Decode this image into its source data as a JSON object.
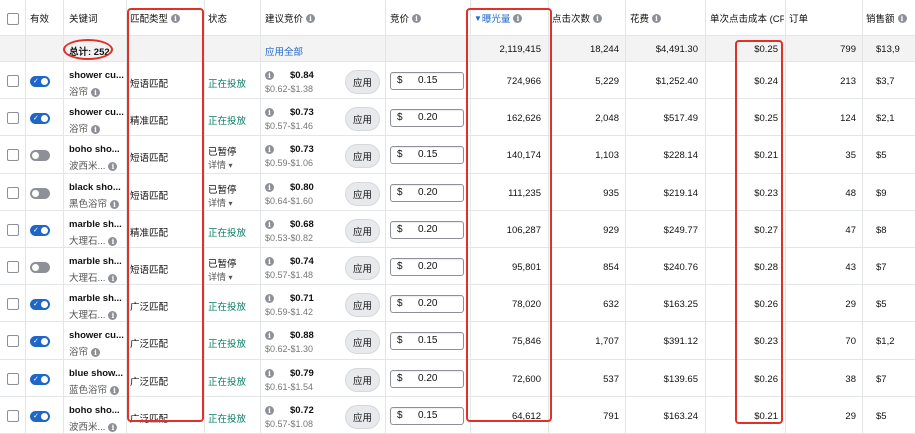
{
  "columns": {
    "enabled": "有效",
    "keyword": "关键词",
    "match_type": "匹配类型",
    "status": "状态",
    "suggested_bid": "建议竞价",
    "bid": "竞价",
    "impressions": "曝光量",
    "clicks": "点击次数",
    "spend": "花费",
    "cpc": "单次点击成本 (CPC",
    "orders": "订单",
    "sales": "销售额"
  },
  "sort_icon": "sort-desc-icon",
  "summary": {
    "total_label": "总计: 252",
    "apply_all": "应用全部",
    "impressions": "2,119,415",
    "clicks": "18,244",
    "spend": "$4,491.30",
    "cpc": "$0.25",
    "orders": "799",
    "sales": "$13,9"
  },
  "apply_label": "应用",
  "detail_label": "详情",
  "currency_symbol": "$",
  "colors": {
    "accent": "#1f66c9",
    "active_status": "#067d62",
    "highlight_red": "#e0302a"
  },
  "rows": [
    {
      "enabled": true,
      "kw": "shower cu...",
      "kw_sub": "浴帘",
      "match": "短语匹配",
      "status": "正在投放",
      "paused": false,
      "bid_sug": "$0.84",
      "bid_range": "$0.62-$1.38",
      "bid": "0.15",
      "impressions": "724,966",
      "clicks": "5,229",
      "spend": "$1,252.40",
      "cpc": "$0.24",
      "orders": "213",
      "sales": "$3,7"
    },
    {
      "enabled": true,
      "kw": "shower cu...",
      "kw_sub": "浴帘",
      "match": "精准匹配",
      "status": "正在投放",
      "paused": false,
      "bid_sug": "$0.73",
      "bid_range": "$0.57-$1.46",
      "bid": "0.20",
      "impressions": "162,626",
      "clicks": "2,048",
      "spend": "$517.49",
      "cpc": "$0.25",
      "orders": "124",
      "sales": "$2,1"
    },
    {
      "enabled": false,
      "kw": "boho sho...",
      "kw_sub": "波西米...",
      "match": "短语匹配",
      "status": "已暂停",
      "paused": true,
      "bid_sug": "$0.73",
      "bid_range": "$0.59-$1.06",
      "bid": "0.15",
      "impressions": "140,174",
      "clicks": "1,103",
      "spend": "$228.14",
      "cpc": "$0.21",
      "orders": "35",
      "sales": "$5"
    },
    {
      "enabled": false,
      "kw": "black sho...",
      "kw_sub": "黑色浴帘",
      "match": "短语匹配",
      "status": "已暂停",
      "paused": true,
      "bid_sug": "$0.80",
      "bid_range": "$0.64-$1.60",
      "bid": "0.20",
      "impressions": "111,235",
      "clicks": "935",
      "spend": "$219.14",
      "cpc": "$0.23",
      "orders": "48",
      "sales": "$9"
    },
    {
      "enabled": true,
      "kw": "marble sh...",
      "kw_sub": "大理石...",
      "match": "精准匹配",
      "status": "正在投放",
      "paused": false,
      "bid_sug": "$0.68",
      "bid_range": "$0.53-$0.82",
      "bid": "0.20",
      "impressions": "106,287",
      "clicks": "929",
      "spend": "$249.77",
      "cpc": "$0.27",
      "orders": "47",
      "sales": "$8"
    },
    {
      "enabled": false,
      "kw": "marble sh...",
      "kw_sub": "大理石...",
      "match": "短语匹配",
      "status": "已暂停",
      "paused": true,
      "bid_sug": "$0.74",
      "bid_range": "$0.57-$1.48",
      "bid": "0.20",
      "impressions": "95,801",
      "clicks": "854",
      "spend": "$240.76",
      "cpc": "$0.28",
      "orders": "43",
      "sales": "$7"
    },
    {
      "enabled": true,
      "kw": "marble sh...",
      "kw_sub": "大理石...",
      "match": "广泛匹配",
      "status": "正在投放",
      "paused": false,
      "bid_sug": "$0.71",
      "bid_range": "$0.59-$1.42",
      "bid": "0.20",
      "impressions": "78,020",
      "clicks": "632",
      "spend": "$163.25",
      "cpc": "$0.26",
      "orders": "29",
      "sales": "$5"
    },
    {
      "enabled": true,
      "kw": "shower cu...",
      "kw_sub": "浴帘",
      "match": "广泛匹配",
      "status": "正在投放",
      "paused": false,
      "bid_sug": "$0.88",
      "bid_range": "$0.62-$1.30",
      "bid": "0.15",
      "impressions": "75,846",
      "clicks": "1,707",
      "spend": "$391.12",
      "cpc": "$0.23",
      "orders": "70",
      "sales": "$1,2"
    },
    {
      "enabled": true,
      "kw": "blue show...",
      "kw_sub": "蓝色浴帘",
      "match": "广泛匹配",
      "status": "正在投放",
      "paused": false,
      "bid_sug": "$0.79",
      "bid_range": "$0.61-$1.54",
      "bid": "0.20",
      "impressions": "72,600",
      "clicks": "537",
      "spend": "$139.65",
      "cpc": "$0.26",
      "orders": "38",
      "sales": "$7"
    },
    {
      "enabled": true,
      "kw": "boho sho...",
      "kw_sub": "波西米...",
      "match": "广泛匹配",
      "status": "正在投放",
      "paused": false,
      "bid_sug": "$0.72",
      "bid_range": "$0.57-$1.08",
      "bid": "0.15",
      "impressions": "64,612",
      "clicks": "791",
      "spend": "$163.24",
      "cpc": "$0.21",
      "orders": "29",
      "sales": "$5"
    }
  ]
}
